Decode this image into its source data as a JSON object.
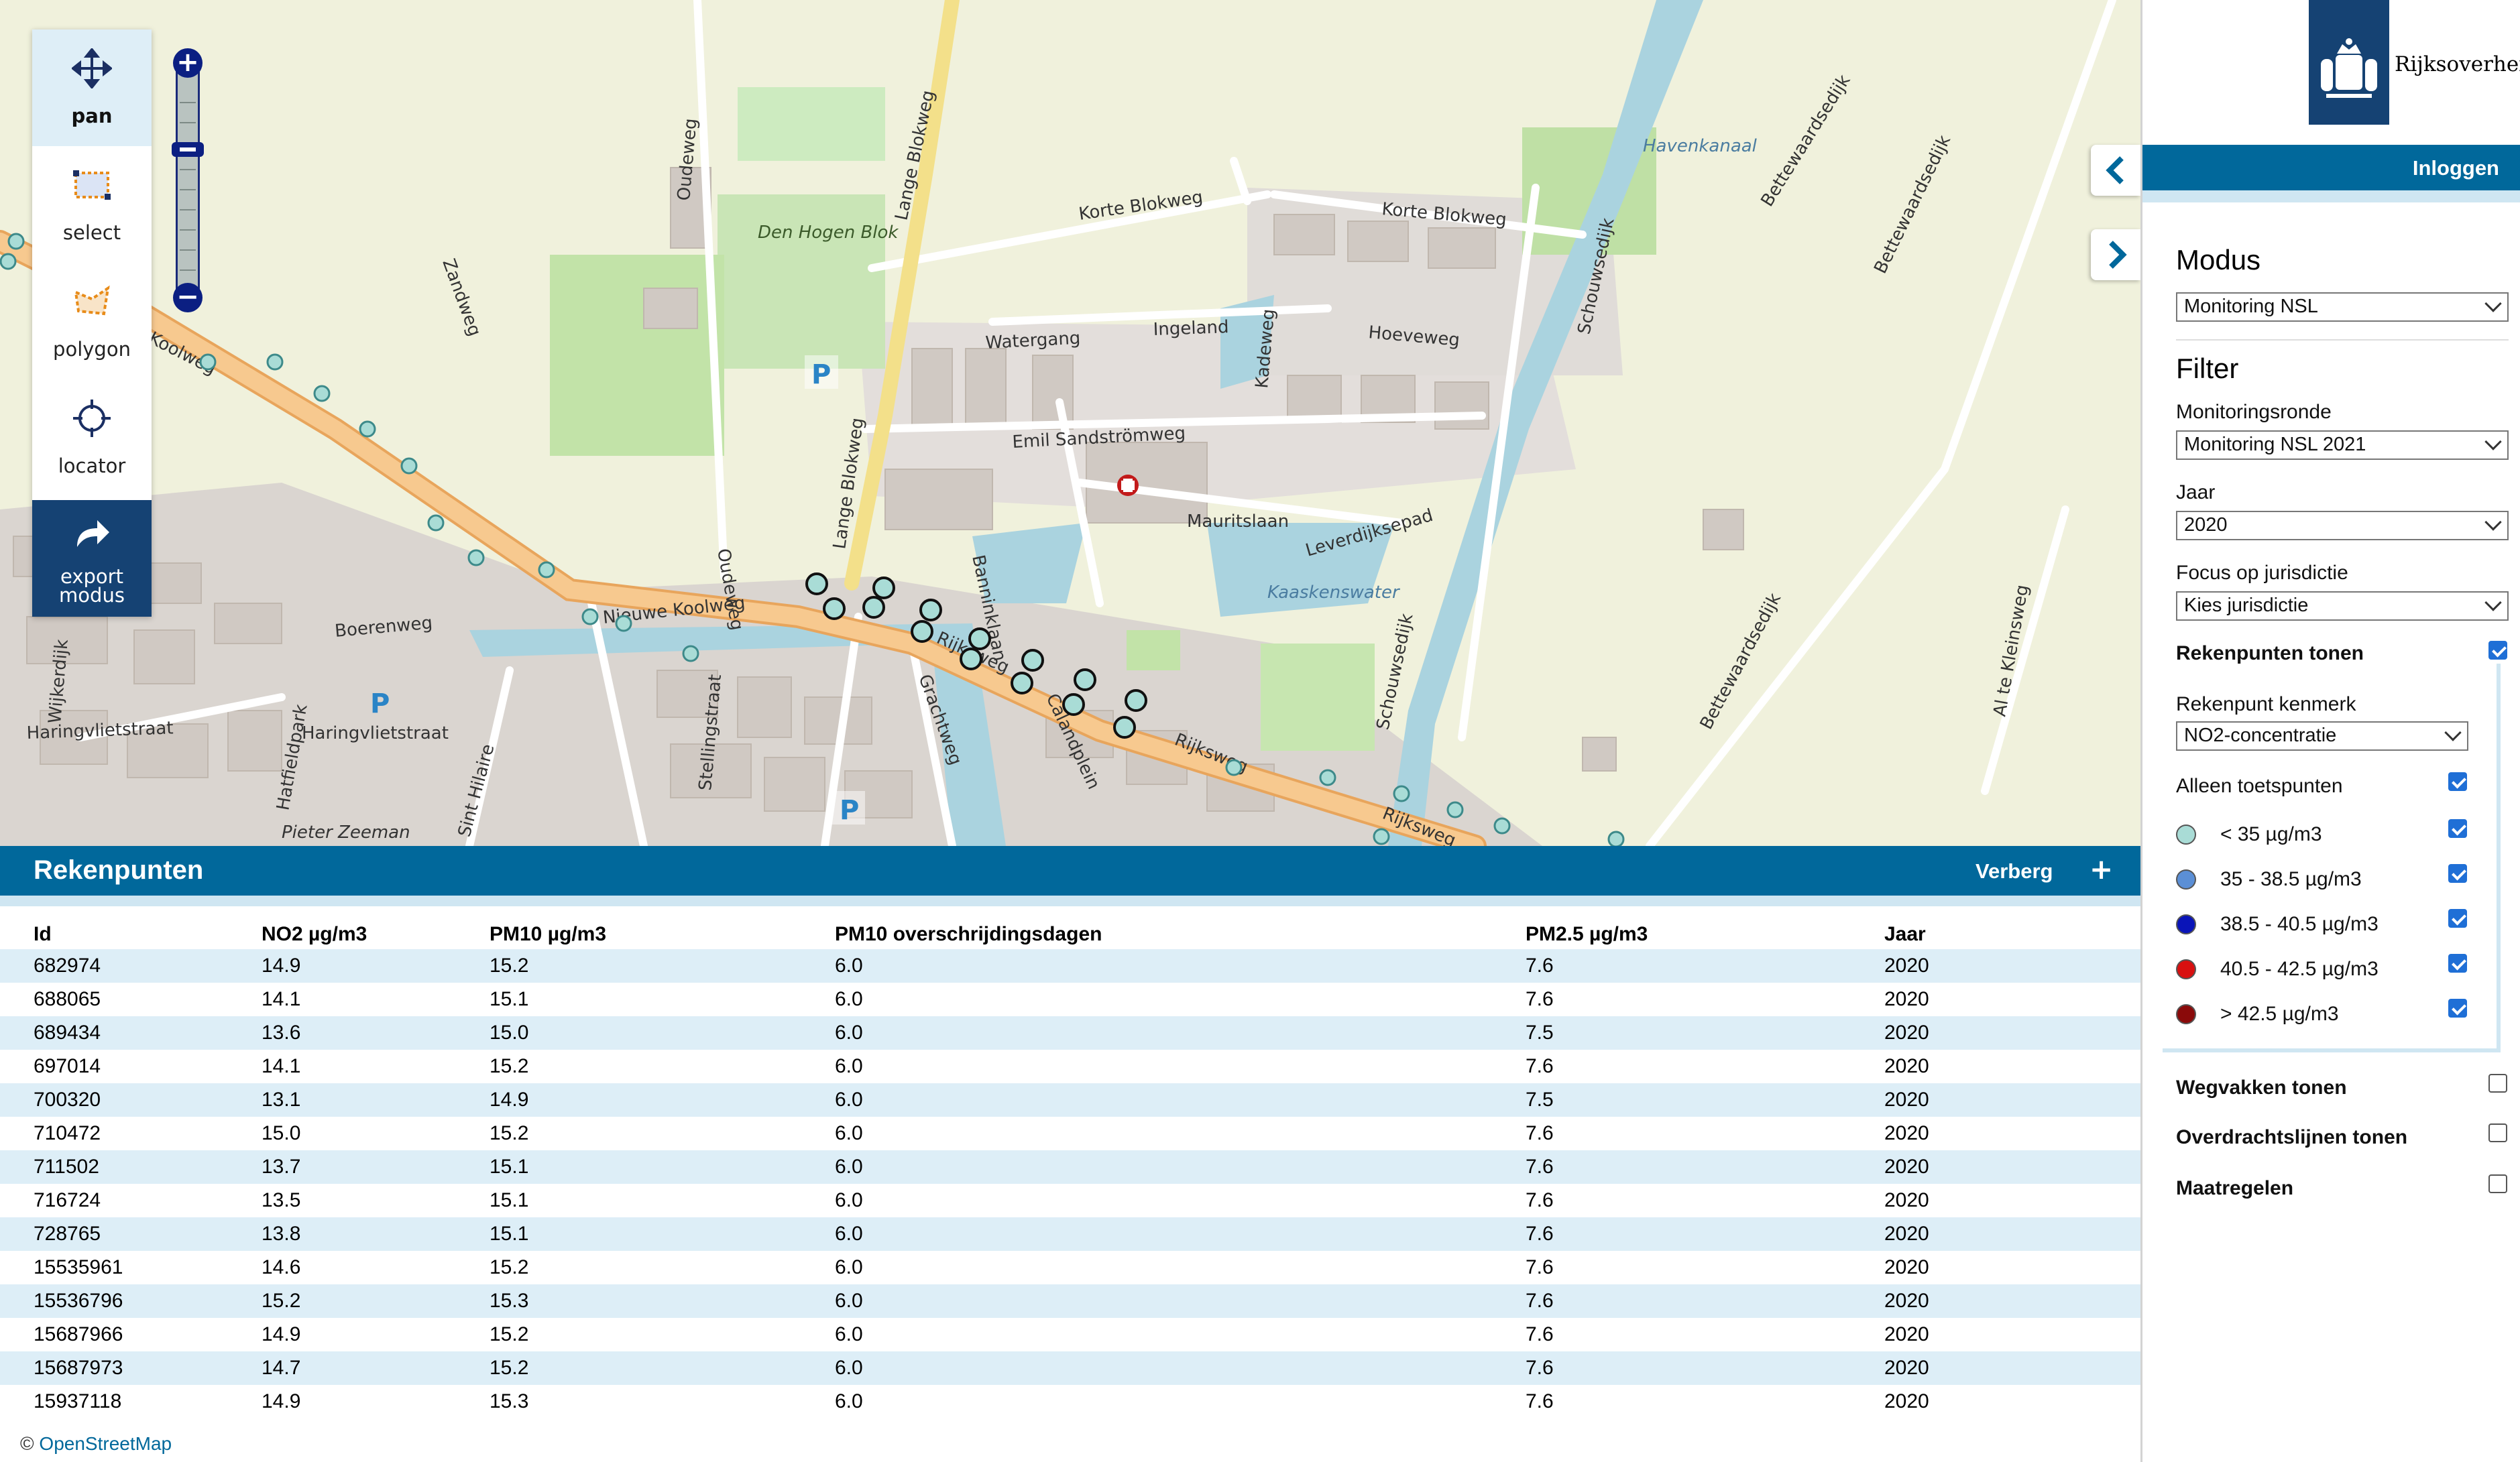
{
  "toolbar": {
    "tools": [
      {
        "label": "pan",
        "icon": "move-arrows-icon"
      },
      {
        "label": "select",
        "icon": "select-rectangle-icon"
      },
      {
        "label": "polygon",
        "icon": "polygon-icon"
      },
      {
        "label": "locator",
        "icon": "crosshair-icon"
      },
      {
        "label_line1": "export",
        "label_line2": "modus",
        "icon": "share-arrow-icon"
      }
    ]
  },
  "zoom": {
    "plus": "+",
    "minus": "−"
  },
  "map": {
    "labels": {
      "koolweg": "Koolweg",
      "nieuwe_koolweg": "Nieuwe Koolweg",
      "lange_blokweg": "Lange Blokweg",
      "lange_blokweg2": "Lange Blokweg",
      "korte_blokweg": "Korte Blokweg",
      "korte_blokweg2": "Korte Blokweg",
      "den_hogen_blok": "Den Hogen Blok",
      "havenkanaal": "Havenkanaal",
      "oudeweg": "Oudeweg",
      "oudeweg2": "Oudeweg",
      "zandweg": "Zandweg",
      "boerenweg": "Boerenweg",
      "haringvlietstraat": "Haringvlietstraat",
      "haringvlietstraat2": "Haringvlietstraat",
      "rijksweg": "Rijksweg",
      "rijksweg2": "Rijksweg",
      "rijksweg3": "Rijksweg",
      "emil": "Emil Sandströmweg",
      "mauritslaan": "Mauritslaan",
      "leverdijksepad": "Leverdijksepad",
      "kaaskenswater": "Kaaskenswater",
      "ingeland": "Ingeland",
      "watergang": "Watergang",
      "hoeveweg": "Hoeveweg",
      "kadeweg": "Kadeweg",
      "schouwsedijk": "Schouwsedijk",
      "bettewaardsedijk": "Bettewaardsedijk",
      "pieter_zeeman": "Pieter Zeeman",
      "sint_hilaire": "Sint Hilaire",
      "baanderslaan": "Banninklaan",
      "calandplein": "Calandplein",
      "gracht": "Grachtweg",
      "hatfield": "Hatfieldpark",
      "stellingstraat": "Stellingstraat",
      "al_te_kleinsweg": "Al te Kleinsweg",
      "wijkerdijk": "Wijkerdijk",
      "parking": "P"
    }
  },
  "panel": {
    "title": "Rekenpunten",
    "toggle": "Verberg",
    "plus": "+",
    "columns": [
      "Id",
      "NO2 µg/m3",
      "PM10 µg/m3",
      "PM10 overschrijdingsdagen",
      "PM2.5 µg/m3",
      "Jaar"
    ],
    "rows": [
      [
        "682974",
        "14.9",
        "15.2",
        "6.0",
        "7.6",
        "2020"
      ],
      [
        "688065",
        "14.1",
        "15.1",
        "6.0",
        "7.6",
        "2020"
      ],
      [
        "689434",
        "13.6",
        "15.0",
        "6.0",
        "7.5",
        "2020"
      ],
      [
        "697014",
        "14.1",
        "15.2",
        "6.0",
        "7.6",
        "2020"
      ],
      [
        "700320",
        "13.1",
        "14.9",
        "6.0",
        "7.5",
        "2020"
      ],
      [
        "710472",
        "15.0",
        "15.2",
        "6.0",
        "7.6",
        "2020"
      ],
      [
        "711502",
        "13.7",
        "15.1",
        "6.0",
        "7.6",
        "2020"
      ],
      [
        "716724",
        "13.5",
        "15.1",
        "6.0",
        "7.6",
        "2020"
      ],
      [
        "728765",
        "13.8",
        "15.1",
        "6.0",
        "7.6",
        "2020"
      ],
      [
        "15535961",
        "14.6",
        "15.2",
        "6.0",
        "7.6",
        "2020"
      ],
      [
        "15536796",
        "15.2",
        "15.3",
        "6.0",
        "7.6",
        "2020"
      ],
      [
        "15687966",
        "14.9",
        "15.2",
        "6.0",
        "7.6",
        "2020"
      ],
      [
        "15687973",
        "14.7",
        "15.2",
        "6.0",
        "7.6",
        "2020"
      ],
      [
        "15937118",
        "14.9",
        "15.3",
        "6.0",
        "7.6",
        "2020"
      ]
    ]
  },
  "attribution": {
    "prefix": "© ",
    "link": "OpenStreetMap"
  },
  "sidebar": {
    "brand": "Rijksoverheid",
    "login": "Inloggen",
    "modus_heading": "Modus",
    "modus_value": "Monitoring NSL",
    "filter_heading": "Filter",
    "ronde_label": "Monitoringsronde",
    "ronde_value": "Monitoring NSL 2021",
    "jaar_label": "Jaar",
    "jaar_value": "2020",
    "focus_label": "Focus op jurisdictie",
    "focus_value": "Kies jurisdictie",
    "rekenpunten_tonen": "Rekenpunten tonen",
    "kenmerk_label": "Rekenpunt kenmerk",
    "kenmerk_value": "NO2-concentratie",
    "alleen_toetspunten": "Alleen toetspunten",
    "legend": [
      {
        "label": "< 35 µg/m3",
        "color": "#a9dcd6"
      },
      {
        "label": "35 - 38.5 µg/m3",
        "color": "#5b8fd6"
      },
      {
        "label": "38.5 - 40.5 µg/m3",
        "color": "#0a14b8"
      },
      {
        "label": "40.5 - 42.5 µg/m3",
        "color": "#d81010"
      },
      {
        "label": "> 42.5 µg/m3",
        "color": "#8a0a0a"
      }
    ],
    "wegvakken": "Wegvakken tonen",
    "overdracht": "Overdrachtslijnen tonen",
    "maatregelen": "Maatregelen"
  },
  "colors": {
    "primary": "#01689b",
    "brand_dark": "#154273",
    "road_main": "#f7c98f",
    "water": "#aad3df"
  }
}
